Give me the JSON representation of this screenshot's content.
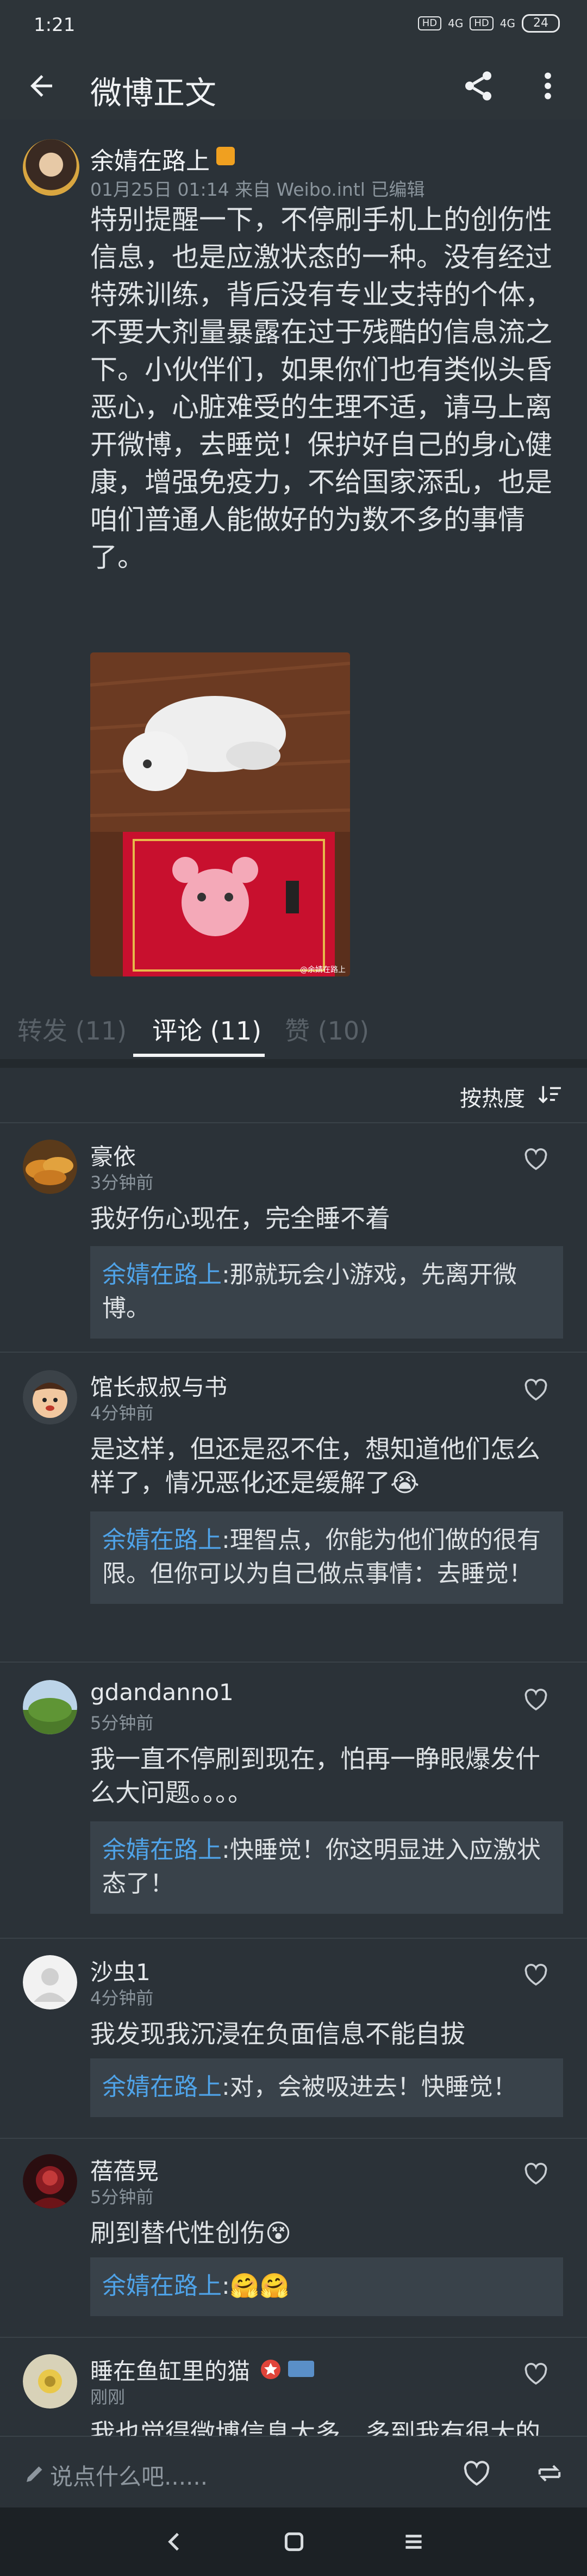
{
  "status": {
    "time": "1:21",
    "net1": "4G",
    "net2": "4G",
    "battery": "24"
  },
  "appbar": {
    "title": "微博正文"
  },
  "post": {
    "author": "余婧在路上",
    "meta": "01月25日 01:14 来自 Weibo.intl  已编辑",
    "content": "特别提醒一下，不停刷手机上的创伤性信息，也是应激状态的一种。没有经过特殊训练，背后没有专业支持的个体，不要大剂量暴露在过于残酷的信息流之下。小伙伴们，如果你们也有类似头昏恶心，心脏难受的生理不适，请马上离开微博，去睡觉！保护好自己的身心健康，增强免疫力，不给国家添乱，也是咱们普通人能做好的为数不多的事情了。",
    "watermark": "@余婧在路上"
  },
  "tabs": {
    "repost": "转发 (11)",
    "comment": "评论 (11)",
    "like": "赞 (10)"
  },
  "sort": {
    "label": "按热度"
  },
  "comments": [
    {
      "name": "豪依",
      "time": "3分钟前",
      "text": "我好伤心现在，完全睡不着",
      "reply_author": "余婧在路上",
      "reply_text": ":那就玩会小游戏，先离开微博。"
    },
    {
      "name": "馆长叔叔与书",
      "time": "4分钟前",
      "text": "是这样，但还是忍不住，想知道他们怎么样了，情况恶化还是缓解了😭",
      "reply_author": "余婧在路上",
      "reply_text": ":理智点，你能为他们做的很有限。但你可以为自己做点事情：去睡觉！"
    },
    {
      "name": "gdandanno1",
      "time": "5分钟前",
      "text": "我一直不停刷到现在，怕再一睁眼爆发什么大问题。。。。",
      "reply_author": "余婧在路上",
      "reply_text": ":快睡觉！你这明显进入应激状态了！"
    },
    {
      "name": "沙虫1",
      "time": "4分钟前",
      "text": "我发现我沉浸在负面信息不能自拔",
      "reply_author": "余婧在路上",
      "reply_text": ":对，会被吸进去！快睡觉！"
    },
    {
      "name": "蓓蓓晃",
      "time": "5分钟前",
      "text": "刷到替代性创伤😵",
      "reply_author": "余婧在路上",
      "reply_text": ":🤗🤗"
    },
    {
      "name": "睡在鱼缸里的猫",
      "time": "刚刚",
      "text": "我也觉得微博信息太多，多到我有很大的"
    }
  ],
  "input": {
    "placeholder": "说点什么吧......"
  }
}
